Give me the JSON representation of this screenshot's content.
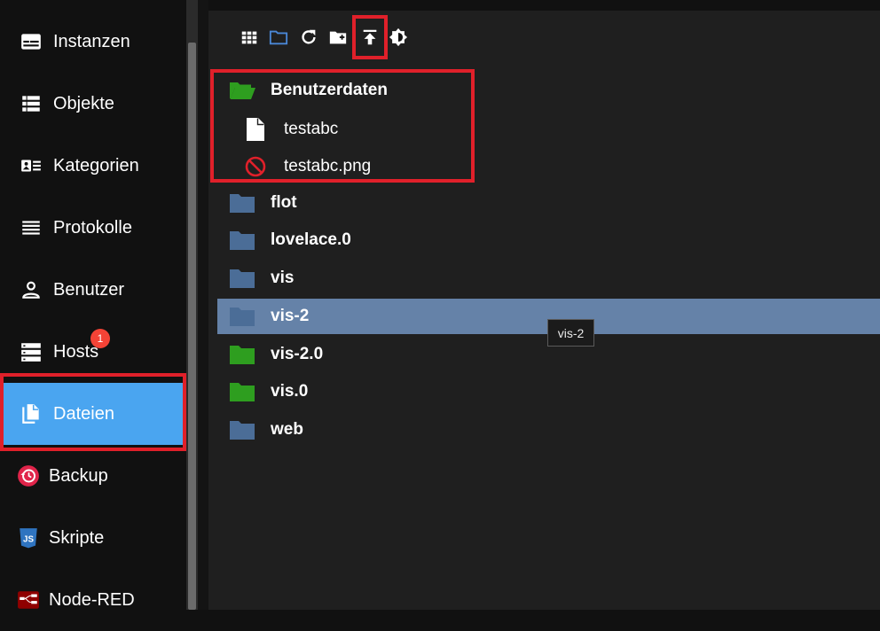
{
  "sidebar": {
    "items": [
      {
        "label": "Instanzen",
        "icon": "instances-icon"
      },
      {
        "label": "Objekte",
        "icon": "list-icon"
      },
      {
        "label": "Kategorien",
        "icon": "categories-icon"
      },
      {
        "label": "Protokolle",
        "icon": "logs-icon"
      },
      {
        "label": "Benutzer",
        "icon": "user-icon"
      },
      {
        "label": "Hosts",
        "icon": "hosts-icon",
        "badge": "1"
      },
      {
        "label": "Dateien",
        "icon": "files-icon",
        "active": true
      },
      {
        "label": "Backup",
        "icon": "backup-icon"
      },
      {
        "label": "Skripte",
        "icon": "javascript-icon"
      },
      {
        "label": "Node-RED",
        "icon": "node-red-icon"
      }
    ]
  },
  "toolbar": {
    "buttons": [
      {
        "icon": "grid-view-icon"
      },
      {
        "icon": "folder-icon"
      },
      {
        "icon": "refresh-icon"
      },
      {
        "icon": "create-folder-icon"
      },
      {
        "icon": "upload-icon"
      },
      {
        "icon": "brightness-icon"
      }
    ]
  },
  "tree": {
    "folders": [
      {
        "name": "Benutzerdaten",
        "icon": "folder-open-icon",
        "color": "#2e9e1f",
        "expanded": true,
        "children": [
          {
            "name": "testabc",
            "icon": "file-icon"
          },
          {
            "name": "testabc.png",
            "icon": "no-preview-icon"
          }
        ]
      },
      {
        "name": "flot",
        "icon": "folder-icon",
        "color": "#4b6d97"
      },
      {
        "name": "lovelace.0",
        "icon": "folder-icon",
        "color": "#4b6d97"
      },
      {
        "name": "vis",
        "icon": "folder-icon",
        "color": "#4b6d97"
      },
      {
        "name": "vis-2",
        "icon": "folder-icon",
        "color": "#4b6d97",
        "selected": true
      },
      {
        "name": "vis-2.0",
        "icon": "folder-icon",
        "color": "#2e9e1f"
      },
      {
        "name": "vis.0",
        "icon": "folder-icon",
        "color": "#2e9e1f"
      },
      {
        "name": "web",
        "icon": "folder-icon",
        "color": "#4b6d97"
      }
    ]
  },
  "tooltip": {
    "text": "vis-2"
  },
  "colors": {
    "accent": "#4aa5f0",
    "selected_row": "#6582a8",
    "highlight": "#e0202a",
    "badge": "#f44336"
  }
}
